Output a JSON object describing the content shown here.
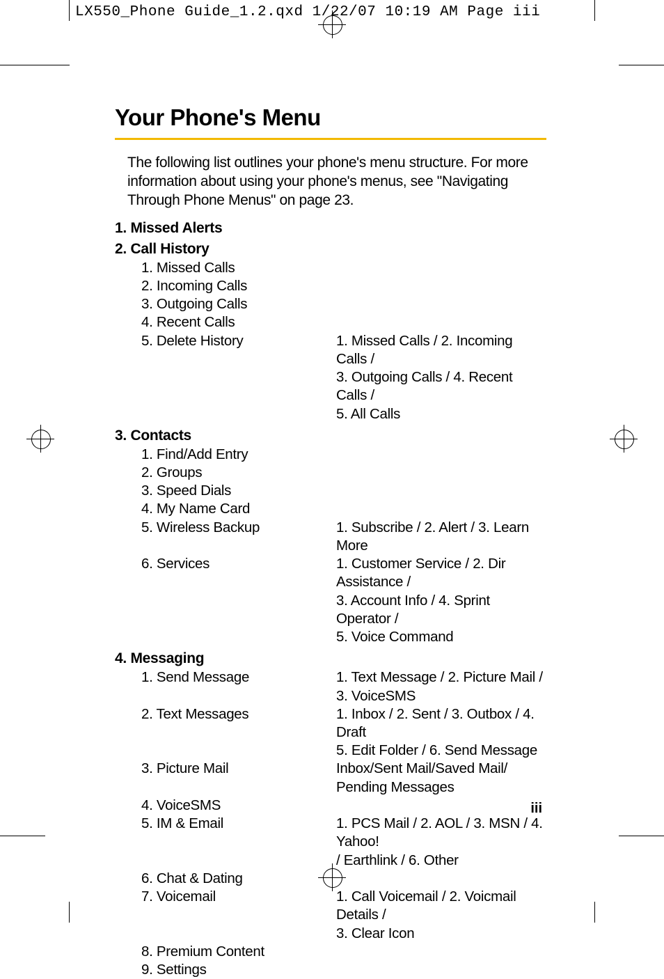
{
  "slug": "LX550_Phone Guide_1.2.qxd  1/22/07  10:19 AM  Page iii",
  "title": "Your Phone's Menu",
  "intro": "The following list outlines your phone's menu structure. For more information about using your phone's menus, see \"Navigating Through Phone Menus\" on page 23.",
  "page_num": "iii",
  "sections": [
    {
      "head": "1. Missed Alerts",
      "items": []
    },
    {
      "head": "2. Call History",
      "items": [
        {
          "left": "1.  Missed Calls",
          "right": ""
        },
        {
          "left": "2.  Incoming Calls",
          "right": ""
        },
        {
          "left": "3.  Outgoing Calls",
          "right": ""
        },
        {
          "left": "4.  Recent Calls",
          "right": ""
        },
        {
          "left": "5.  Delete History",
          "right": "1. Missed Calls / 2. Incoming Calls /"
        },
        {
          "left": "",
          "right": "3. Outgoing Calls / 4. Recent Calls /"
        },
        {
          "left": "",
          "right": "5. All Calls"
        }
      ]
    },
    {
      "head": "3. Contacts",
      "items": [
        {
          "left": "1.  Find/Add  Entry",
          "right": ""
        },
        {
          "left": "2.  Groups",
          "right": ""
        },
        {
          "left": "3.  Speed Dials",
          "right": ""
        },
        {
          "left": "4.  My Name Card",
          "right": ""
        },
        {
          "left": "5.  Wireless Backup",
          "right": "1. Subscribe / 2. Alert / 3. Learn More"
        },
        {
          "left": "6.  Services",
          "right": "1. Customer Service / 2. Dir Assistance /"
        },
        {
          "left": "",
          "right": "3. Account Info / 4. Sprint Operator /"
        },
        {
          "left": "",
          "right": "5. Voice Command"
        }
      ]
    },
    {
      "head": "4. Messaging",
      "items": [
        {
          "left": "1.  Send Message",
          "right": "1. Text Message / 2. Picture Mail /"
        },
        {
          "left": "",
          "right": "3. VoiceSMS"
        },
        {
          "left": "2.  Text Messages",
          "right": "1. Inbox / 2. Sent / 3. Outbox / 4. Draft"
        },
        {
          "left": "",
          "right": "5. Edit Folder / 6. Send Message"
        },
        {
          "left": "3.  Picture Mail",
          "right": "Inbox/Sent Mail/Saved Mail/"
        },
        {
          "left": "",
          "right": "Pending Messages"
        },
        {
          "left": "4.  VoiceSMS",
          "right": ""
        },
        {
          "left": "5.  IM & Email",
          "right": "1. PCS Mail / 2. AOL / 3. MSN / 4. Yahoo!"
        },
        {
          "left": "",
          "right": " / Earthlink / 6. Other"
        },
        {
          "left": "6.  Chat & Dating",
          "right": ""
        },
        {
          "left": "7.  Voicemail",
          "right": "1. Call Voicemail / 2. Voicmail Details /"
        },
        {
          "left": "",
          "right": "3. Clear Icon"
        },
        {
          "left": "8.  Premium Content",
          "right": ""
        },
        {
          "left": "9.  Settings",
          "right": ""
        }
      ]
    }
  ]
}
